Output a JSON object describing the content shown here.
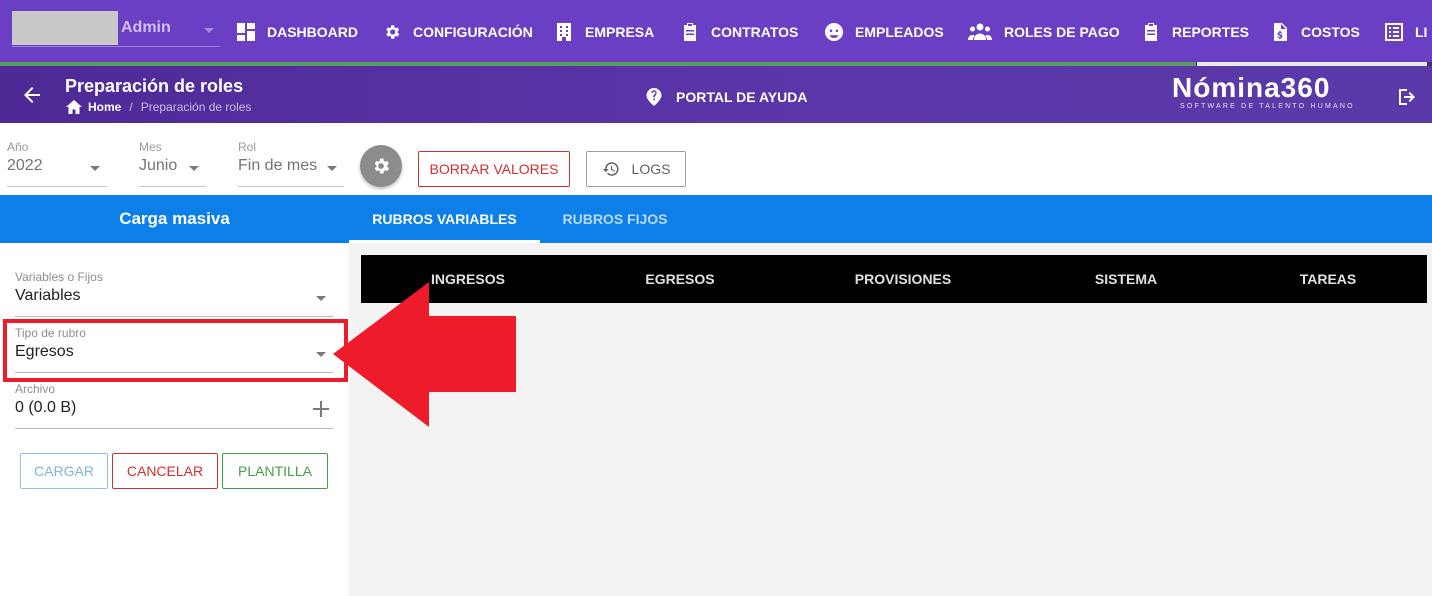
{
  "topnav": {
    "user_name": "Admin",
    "items": [
      {
        "label": "DASHBOARD",
        "icon": "dashboard-icon"
      },
      {
        "label": "CONFIGURACIÓN",
        "icon": "gear-icon"
      },
      {
        "label": "EMPRESA",
        "icon": "building-icon"
      },
      {
        "label": "CONTRATOS",
        "icon": "clipboard-icon"
      },
      {
        "label": "EMPLEADOS",
        "icon": "face-icon"
      },
      {
        "label": "ROLES DE PAGO",
        "icon": "users-icon"
      },
      {
        "label": "REPORTES",
        "icon": "clipboard-list-icon"
      },
      {
        "label": "COSTOS",
        "icon": "invoice-icon"
      },
      {
        "label": "LI",
        "icon": "list-icon"
      }
    ]
  },
  "header": {
    "title": "Preparación de roles",
    "breadcrumb": {
      "home": "Home",
      "current": "Preparación de roles"
    },
    "help_label": "PORTAL DE AYUDA",
    "logo_main": "Nómina360",
    "logo_sub": "SOFTWARE DE TALENTO HUMANO"
  },
  "filters": {
    "year": {
      "label": "Año",
      "value": "2022"
    },
    "month": {
      "label": "Mes",
      "value": "Junio"
    },
    "role": {
      "label": "Rol",
      "value": "Fin de mes"
    },
    "borrar_label": "BORRAR VALORES",
    "logs_label": "LOGS"
  },
  "left_panel": {
    "title": "Carga masiva",
    "variables": {
      "label": "Variables o Fijos",
      "value": "Variables"
    },
    "tipo": {
      "label": "Tipo de rubro",
      "value": "Egresos"
    },
    "archivo": {
      "label": "Archivo",
      "value": "0 (0.0 B)"
    },
    "buttons": {
      "cargar": "CARGAR",
      "cancelar": "CANCELAR",
      "plantilla": "PLANTILLA"
    }
  },
  "tabs": [
    {
      "label": "RUBROS VARIABLES",
      "active": true
    },
    {
      "label": "RUBROS FIJOS",
      "active": false
    }
  ],
  "subtabs": [
    "INGRESOS",
    "EGRESOS",
    "PROVISIONES",
    "SISTEMA",
    "TAREAS"
  ],
  "colors": {
    "nav_purple": "#6b3fc4",
    "primary_blue": "#0d7fe8",
    "annotation_red": "#ee1b2b",
    "danger_red": "#d32f2f",
    "success_green": "#43a047"
  }
}
